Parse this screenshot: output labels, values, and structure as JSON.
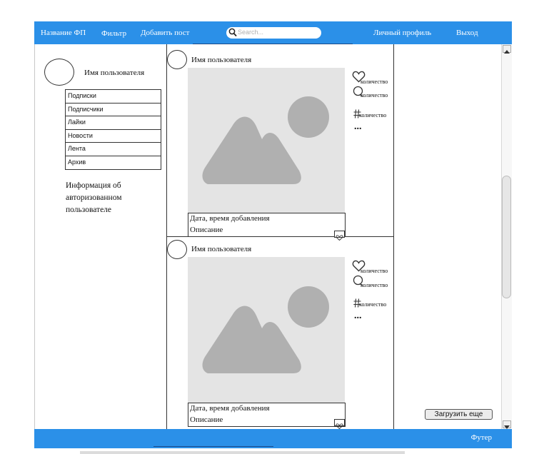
{
  "header": {
    "app_name": "Название ФП",
    "filter": "Фильтр",
    "add_post": "Добавить пост",
    "search_placeholder": "Search...",
    "profile": "Личный профиль",
    "logout": "Выход"
  },
  "sidebar": {
    "username": "Имя пользователя",
    "menu": [
      "Подписки",
      "Подписчики",
      "Лайки",
      "Новости",
      "Лента",
      "Архив"
    ],
    "info": "Информация об авторизованном пользователе"
  },
  "posts": [
    {
      "username": "Имя пользователя",
      "date_label": "Дата, время добавления",
      "description": "Описание",
      "likes_label": "количество",
      "comments_label": "количество",
      "tags_label": "количество",
      "more": "..."
    },
    {
      "username": "Имя пользователя",
      "date_label": "Дата, время добавления",
      "description": "Описание",
      "likes_label": "количество",
      "comments_label": "количество",
      "tags_label": "количество",
      "more": "..."
    }
  ],
  "load_more": "Загрузить еще",
  "footer": {
    "label": "Футер"
  },
  "colors": {
    "accent": "#2b90e8",
    "placeholder_bg": "#e4e4e4",
    "placeholder_shape": "#b0b0b0"
  }
}
